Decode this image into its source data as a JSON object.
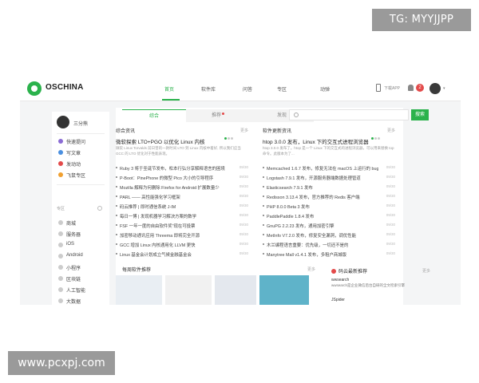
{
  "watermarks": {
    "top": "TG: MYYJJPP",
    "bottom": "www.pcxpj.com"
  },
  "header": {
    "brand": "OSCHINA",
    "nav": [
      "首页",
      "软件库",
      "问答",
      "专区",
      "动弹"
    ],
    "active_nav": "首页",
    "app_label": "下载APP",
    "notification_count": "2"
  },
  "search": {
    "button_label": "搜索"
  },
  "sidebar": {
    "username": "三分熊",
    "items": [
      {
        "label": "快速提问",
        "icon": "question-icon",
        "color": "#8a6bd4"
      },
      {
        "label": "写文章",
        "icon": "edit-icon",
        "color": "#4a8fe0"
      },
      {
        "label": "发动动",
        "icon": "chat-icon",
        "color": "#e34a4a"
      },
      {
        "label": "飞鼠专区",
        "icon": "star-icon",
        "color": "#f0a030"
      }
    ],
    "section_label": "专区",
    "zones": [
      "商城",
      "服务器",
      "iOS",
      "Android",
      "小程序",
      "区块链",
      "人工智能",
      "大数据"
    ]
  },
  "tabs": {
    "items": [
      "综合",
      "推荐",
      "发现"
    ],
    "active": "综合"
  },
  "news": {
    "heading": "综合资讯",
    "more": "更多",
    "lead_title": "微软探索 LTO+PGO 以优化 Linux 内核",
    "lead_summary": "微软 Linux Torvalds 前日曾的一款时间 LTO 到 Linux 内核中着好, 所以我们应当 GCC 的 LTO 优化对于性能表现。",
    "items": [
      {
        "title": "Ruby 3 将于圣诞节发布，松本行弘分享解释语言的困境",
        "date": "09/30"
      },
      {
        "title": "P-Boot：PinePhone 的微型 Pico 大小的引导程序",
        "date": "09/30"
      },
      {
        "title": "Mozilla 解释为何删除 Firefox for Android 扩展数量少",
        "date": "09/30"
      },
      {
        "title": "PARL —— 高性能强化学习框架",
        "date": "09/30"
      },
      {
        "title": "码云推荐 | 即时通信系统 J-IM",
        "date": "09/30"
      },
      {
        "title": "每日一博 | 发现机器学习解决方案的数学",
        "date": "09/30"
      },
      {
        "title": "FSF 一年一度的自由软件奖\"现在可投票",
        "date": "09/30"
      },
      {
        "title": "加密移动通讯应用 Threema 即将完全开源",
        "date": "09/30"
      },
      {
        "title": "GCC 增加 Linux 内核通用化 LLVM 更快",
        "date": "09/30"
      },
      {
        "title": "Linux 基金会计划成立气候金融基金会",
        "date": "09/30"
      }
    ]
  },
  "software": {
    "heading": "软件更新资讯",
    "more": "更多",
    "lead_title": "htop 3.0.0 发布，Linux 下的交互式进程浏览器",
    "lead_summary": "htop 3.0.0 发布了。htop 是一个 Linux 下的交互式的进程浏览器，可以用来替换 top 命令。此版本为了...",
    "items": [
      {
        "title": "Memcached 1.6.7 发布，修复无法在 macOS 上运行的 bug",
        "date": "09/30"
      },
      {
        "title": "Logstash 7.9.1 发布，开源服务器端数据处理管道",
        "date": "09/30"
      },
      {
        "title": "Elasticsearch 7.9.1 发布",
        "date": "09/30"
      },
      {
        "title": "Redisson 3.13.4 发布，官方推荐的 Redis 客户端",
        "date": "09/30"
      },
      {
        "title": "PHP 8.0.0 Beta 3 发布",
        "date": "09/30"
      },
      {
        "title": "PaddlePaddle 1.8.4 发布",
        "date": "09/30"
      },
      {
        "title": "GnuPG 2.2.23 发布，通用加密引擎",
        "date": "09/30"
      },
      {
        "title": "MetInfo V7.2.0 发布，修复安全漏洞，调优性能",
        "date": "09/30"
      },
      {
        "title": "木兰编程语言重要：优先级，一切还不是的",
        "date": "09/30"
      },
      {
        "title": "Manytree Mall v1.4.1 发布，多租户商城版",
        "date": "09/30"
      }
    ]
  },
  "recommend": {
    "heading": "每周软件推荐",
    "more": "更多"
  },
  "gitee": {
    "heading": "码云最新推荐",
    "more": "更多",
    "projects": [
      {
        "name": "wwsearch",
        "desc": "wwsearch是企业微信后台自研的全文检索引擎"
      },
      {
        "name": "JSpider",
        "desc": ""
      }
    ]
  },
  "colors": {
    "accent": "#2bb24c",
    "badge": "#e34a4a"
  }
}
